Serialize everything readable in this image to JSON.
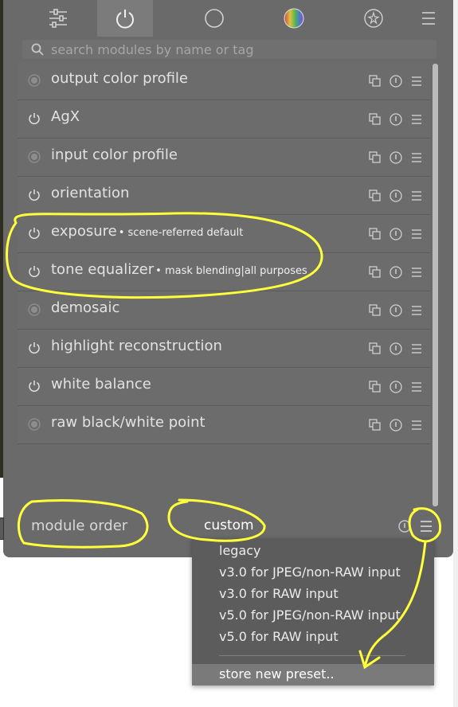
{
  "search": {
    "placeholder": "search modules by name or tag"
  },
  "tabs": [
    {
      "name": "quick-access",
      "icon": "sliders-icon"
    },
    {
      "name": "active-modules",
      "icon": "power-icon",
      "active": true
    },
    {
      "name": "base",
      "icon": "circle-icon"
    },
    {
      "name": "color",
      "icon": "color-wheel-icon"
    },
    {
      "name": "effects",
      "icon": "sparkles-icon"
    },
    {
      "name": "menu",
      "icon": "hamburger-icon"
    }
  ],
  "modules": [
    {
      "name": "output color profile",
      "preset": "",
      "state": "always-on"
    },
    {
      "name": "AgX",
      "preset": "",
      "state": "power"
    },
    {
      "name": "input color profile",
      "preset": "",
      "state": "always-on"
    },
    {
      "name": "orientation",
      "preset": "",
      "state": "power"
    },
    {
      "name": "exposure",
      "preset": "• scene-referred default",
      "state": "power"
    },
    {
      "name": "tone equalizer",
      "preset": "• mask blending|all purposes",
      "state": "power"
    },
    {
      "name": "demosaic",
      "preset": "",
      "state": "always-on"
    },
    {
      "name": "highlight reconstruction",
      "preset": "",
      "state": "power"
    },
    {
      "name": "white balance",
      "preset": "",
      "state": "power"
    },
    {
      "name": "raw black/white point",
      "preset": "",
      "state": "always-on"
    }
  ],
  "module_order": {
    "label": "module order",
    "value": "custom"
  },
  "preset_menu": {
    "items": [
      "legacy",
      "v3.0 for JPEG/non-RAW input",
      "v3.0 for RAW input",
      "v5.0 for JPEG/non-RAW input",
      "v5.0 for RAW input"
    ],
    "store": "store new preset.."
  },
  "colors": {
    "panel": "#6a6a6a",
    "row": "#6c6c6c",
    "text": "#e2e2e2",
    "highlight": "#ffff3a",
    "menu": "#5c5c5c"
  }
}
